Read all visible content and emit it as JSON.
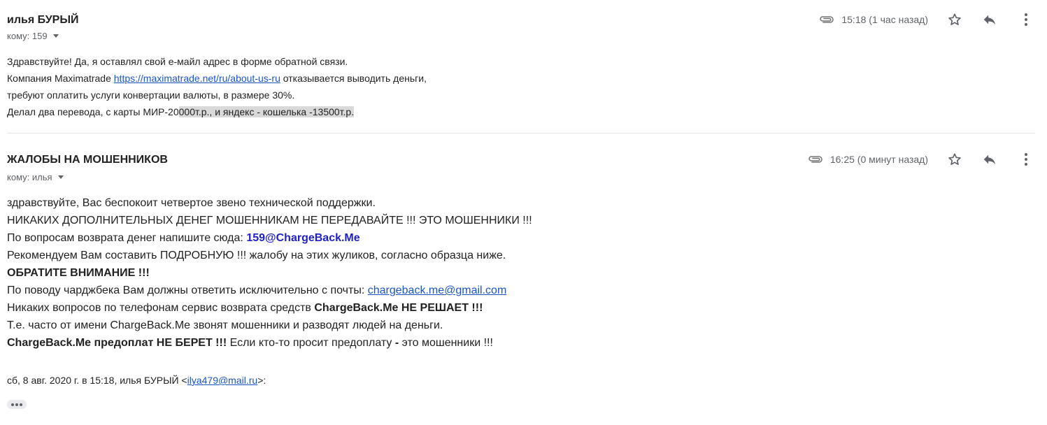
{
  "message1": {
    "sender": "илья БУРЫЙ",
    "to_label": "кому: 159",
    "time": "15:18 (1 час назад)",
    "body": {
      "line1": "Здравствуйте! Да, я оставлял свой е-майл адрес в форме обратной связи.",
      "line2_prefix": "Компания Maximatrade ",
      "line2_link": "https://maximatrade.net/ru/about-us-ru",
      "line2_suffix": " отказывается выводить деньги,",
      "line3": "требуют оплатить услуги конвертации валюты, в размере 30%.",
      "line4_prefix": "Делал два перевода, с карты МИР-20",
      "line4_highlight": "000т.р., и яндекс - кошелька -13500т.р."
    }
  },
  "message2": {
    "sender": "ЖАЛОБЫ НА МОШЕННИКОВ",
    "to_label": "кому: илья",
    "time": "16:25 (0 минут назад)",
    "body": {
      "line1": "здравствуйте, Вас беспокоит четвертое звено технической поддержки.",
      "line2": "НИКАКИХ ДОПОЛНИТЕЛЬНЫХ ДЕНЕГ МОШЕННИКАМ НЕ ПЕРЕДАВАЙТЕ !!! ЭТО МОШЕННИКИ !!!",
      "line3_prefix": "По вопросам возврата денег напишите сюда: ",
      "line3_email": "159@ChargeBack.Me",
      "line4": "Рекомендуем Вам составить ПОДРОБНУЮ !!! жалобу на этих жуликов, согласно образца ниже.",
      "line5": "ОБРАТИТЕ ВНИМАНИЕ !!!",
      "line6_prefix": "По поводу чарджбека Вам должны ответить исключительно с почты: ",
      "line6_link": "chargeback.me@gmail.com",
      "line7_prefix": "Никаких вопросов по телефонам сервис возврата средств ",
      "line7_bold": "ChargeBack.Me НЕ РЕШАЕТ !!!",
      "line8": "Т.е. часто от имени ChargeBack.Me звонят мошенники и разводят людей на деньги.",
      "line9_bold1": "ChargeBack.Me предоплат НЕ БЕРЕТ !!!",
      "line9_middle": " Если кто-то просит предоплату ",
      "line9_bold2": "-",
      "line9_suffix": " это мошенники !!!"
    },
    "quote": {
      "prefix": "сб, 8 авг. 2020 г. в 15:18, илья БУРЫЙ <",
      "email": "ilya479@mail.ru",
      "suffix": ">:"
    }
  },
  "icons": {
    "attachment": "paperclip-icon",
    "star": "star-icon",
    "reply": "reply-icon",
    "more": "more-vert-icon",
    "expand": "ellipsis-icon"
  },
  "colors": {
    "link": "#1a55c8",
    "email_blue": "#1f1fc8",
    "muted": "#5f6368",
    "highlight": "#d9d9d9"
  }
}
